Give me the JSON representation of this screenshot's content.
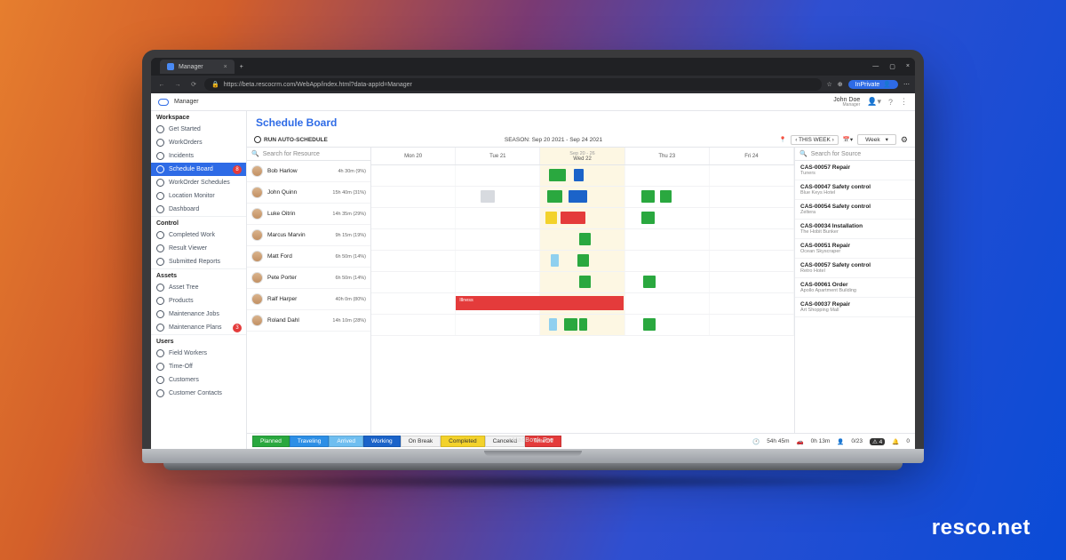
{
  "brand": "resco.net",
  "laptop_label": "MacBook Pro",
  "browser": {
    "tab_title": "Manager",
    "url": "https://beta.rescocrm.com/WebApp/index.html?data-appId=Manager",
    "inprivate": "InPrivate"
  },
  "header": {
    "app_name": "Manager",
    "user_name": "John Doe",
    "user_role": "Manager"
  },
  "sidebar": {
    "groups": [
      {
        "label": "Workspace",
        "items": [
          {
            "label": "Get Started"
          },
          {
            "label": "WorkOrders"
          },
          {
            "label": "Incidents"
          },
          {
            "label": "Schedule Board",
            "active": true,
            "badge": "8"
          },
          {
            "label": "WorkOrder Schedules"
          },
          {
            "label": "Location Monitor"
          },
          {
            "label": "Dashboard"
          }
        ]
      },
      {
        "label": "Control",
        "items": [
          {
            "label": "Completed Work"
          },
          {
            "label": "Result Viewer"
          },
          {
            "label": "Submitted Reports"
          }
        ]
      },
      {
        "label": "Assets",
        "items": [
          {
            "label": "Asset Tree"
          },
          {
            "label": "Products"
          },
          {
            "label": "Maintenance Jobs"
          },
          {
            "label": "Maintenance Plans",
            "badge": "3"
          }
        ]
      },
      {
        "label": "Users",
        "items": [
          {
            "label": "Field Workers"
          },
          {
            "label": "Time-Off"
          },
          {
            "label": "Customers"
          },
          {
            "label": "Customer Contacts"
          }
        ]
      }
    ]
  },
  "page": {
    "title": "Schedule Board",
    "run_auto": "RUN AUTO-SCHEDULE",
    "season": "SEASON: Sep 20 2021 - Sep 24 2021",
    "this_week": "THIS WEEK",
    "view_mode": "Week",
    "search_resource": "Search for Resource",
    "search_source": "Search for Source",
    "week_label": "Sep 20 - 26",
    "days": [
      {
        "label": "Mon 20"
      },
      {
        "label": "Tue 21"
      },
      {
        "label": "Wed 22",
        "today": true
      },
      {
        "label": "Thu 23"
      },
      {
        "label": "Fri 24"
      }
    ],
    "resources": [
      {
        "name": "Bob Harlow",
        "stat": "4h 30m (9%)"
      },
      {
        "name": "John Quinn",
        "stat": "15h 40m (31%)"
      },
      {
        "name": "Luke Oitrin",
        "stat": "14h 35m (29%)"
      },
      {
        "name": "Marcus Marvin",
        "stat": "9h 15m (19%)"
      },
      {
        "name": "Matt Ford",
        "stat": "6h 50m (14%)"
      },
      {
        "name": "Pete Porter",
        "stat": "6h 50m (14%)"
      },
      {
        "name": "Ralf Harper",
        "stat": "40h 0m (80%)",
        "illness": "Illness"
      },
      {
        "name": "Roland Dahl",
        "stat": "14h 10m (28%)"
      }
    ],
    "sources": [
      {
        "id": "CAS-00057 Repair",
        "sub": "Tuners"
      },
      {
        "id": "CAS-00047 Safety control",
        "sub": "Blue Keys Hotel"
      },
      {
        "id": "CAS-00054 Safety control",
        "sub": "Zeltera"
      },
      {
        "id": "CAS-00034 Installation",
        "sub": "The Hobit Bunker"
      },
      {
        "id": "CAS-00051 Repair",
        "sub": "Ocean Skyscraper"
      },
      {
        "id": "CAS-00057 Safety control",
        "sub": "Retro Hotel"
      },
      {
        "id": "CAS-00061 Order",
        "sub": "Apollo Apartment Building"
      },
      {
        "id": "CAS-00037 Repair",
        "sub": "Art Shopping Mall"
      }
    ],
    "statuses": [
      {
        "label": "Planned",
        "cls": "st-planned"
      },
      {
        "label": "Traveling",
        "cls": "st-travel"
      },
      {
        "label": "Arrived",
        "cls": "st-arrived"
      },
      {
        "label": "Working",
        "cls": "st-working"
      },
      {
        "label": "On Break",
        "cls": "st-break"
      },
      {
        "label": "Completed",
        "cls": "st-completed"
      },
      {
        "label": "Canceled",
        "cls": "st-cancel"
      },
      {
        "label": "TimeOff",
        "cls": "st-timeoff"
      }
    ],
    "footer_stats": {
      "a": "54h 45m",
      "b": "0h 13m",
      "c": "0/23",
      "d": "4",
      "e": "0"
    }
  },
  "colors": {
    "green": "#2aa83f",
    "blue": "#2d8fe6",
    "dblue": "#1b63c9",
    "lblue": "#8fd0ef",
    "yellow": "#f3d22b",
    "red": "#e43b3b",
    "grey": "#d7dadf"
  }
}
